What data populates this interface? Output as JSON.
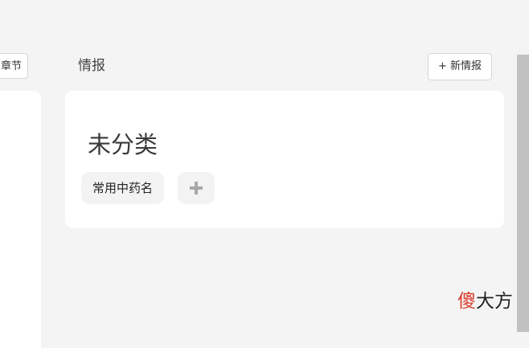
{
  "left_panel": {
    "chapter_button_label": "章节"
  },
  "section": {
    "title": "情报",
    "new_button_label": "+ 新情报"
  },
  "category": {
    "name": "未分类",
    "tags": [
      "常用中药名"
    ],
    "add_icon": "plus-icon"
  },
  "watermark": {
    "part1": "傻",
    "part2": "大方",
    "colors": {
      "part1": "#d93a2b",
      "part2": "#222222"
    }
  },
  "colors": {
    "background": "#f4f4f4",
    "card": "#ffffff",
    "chip": "#f3f3f3",
    "scrollbar_thumb": "#c1c1c1"
  }
}
